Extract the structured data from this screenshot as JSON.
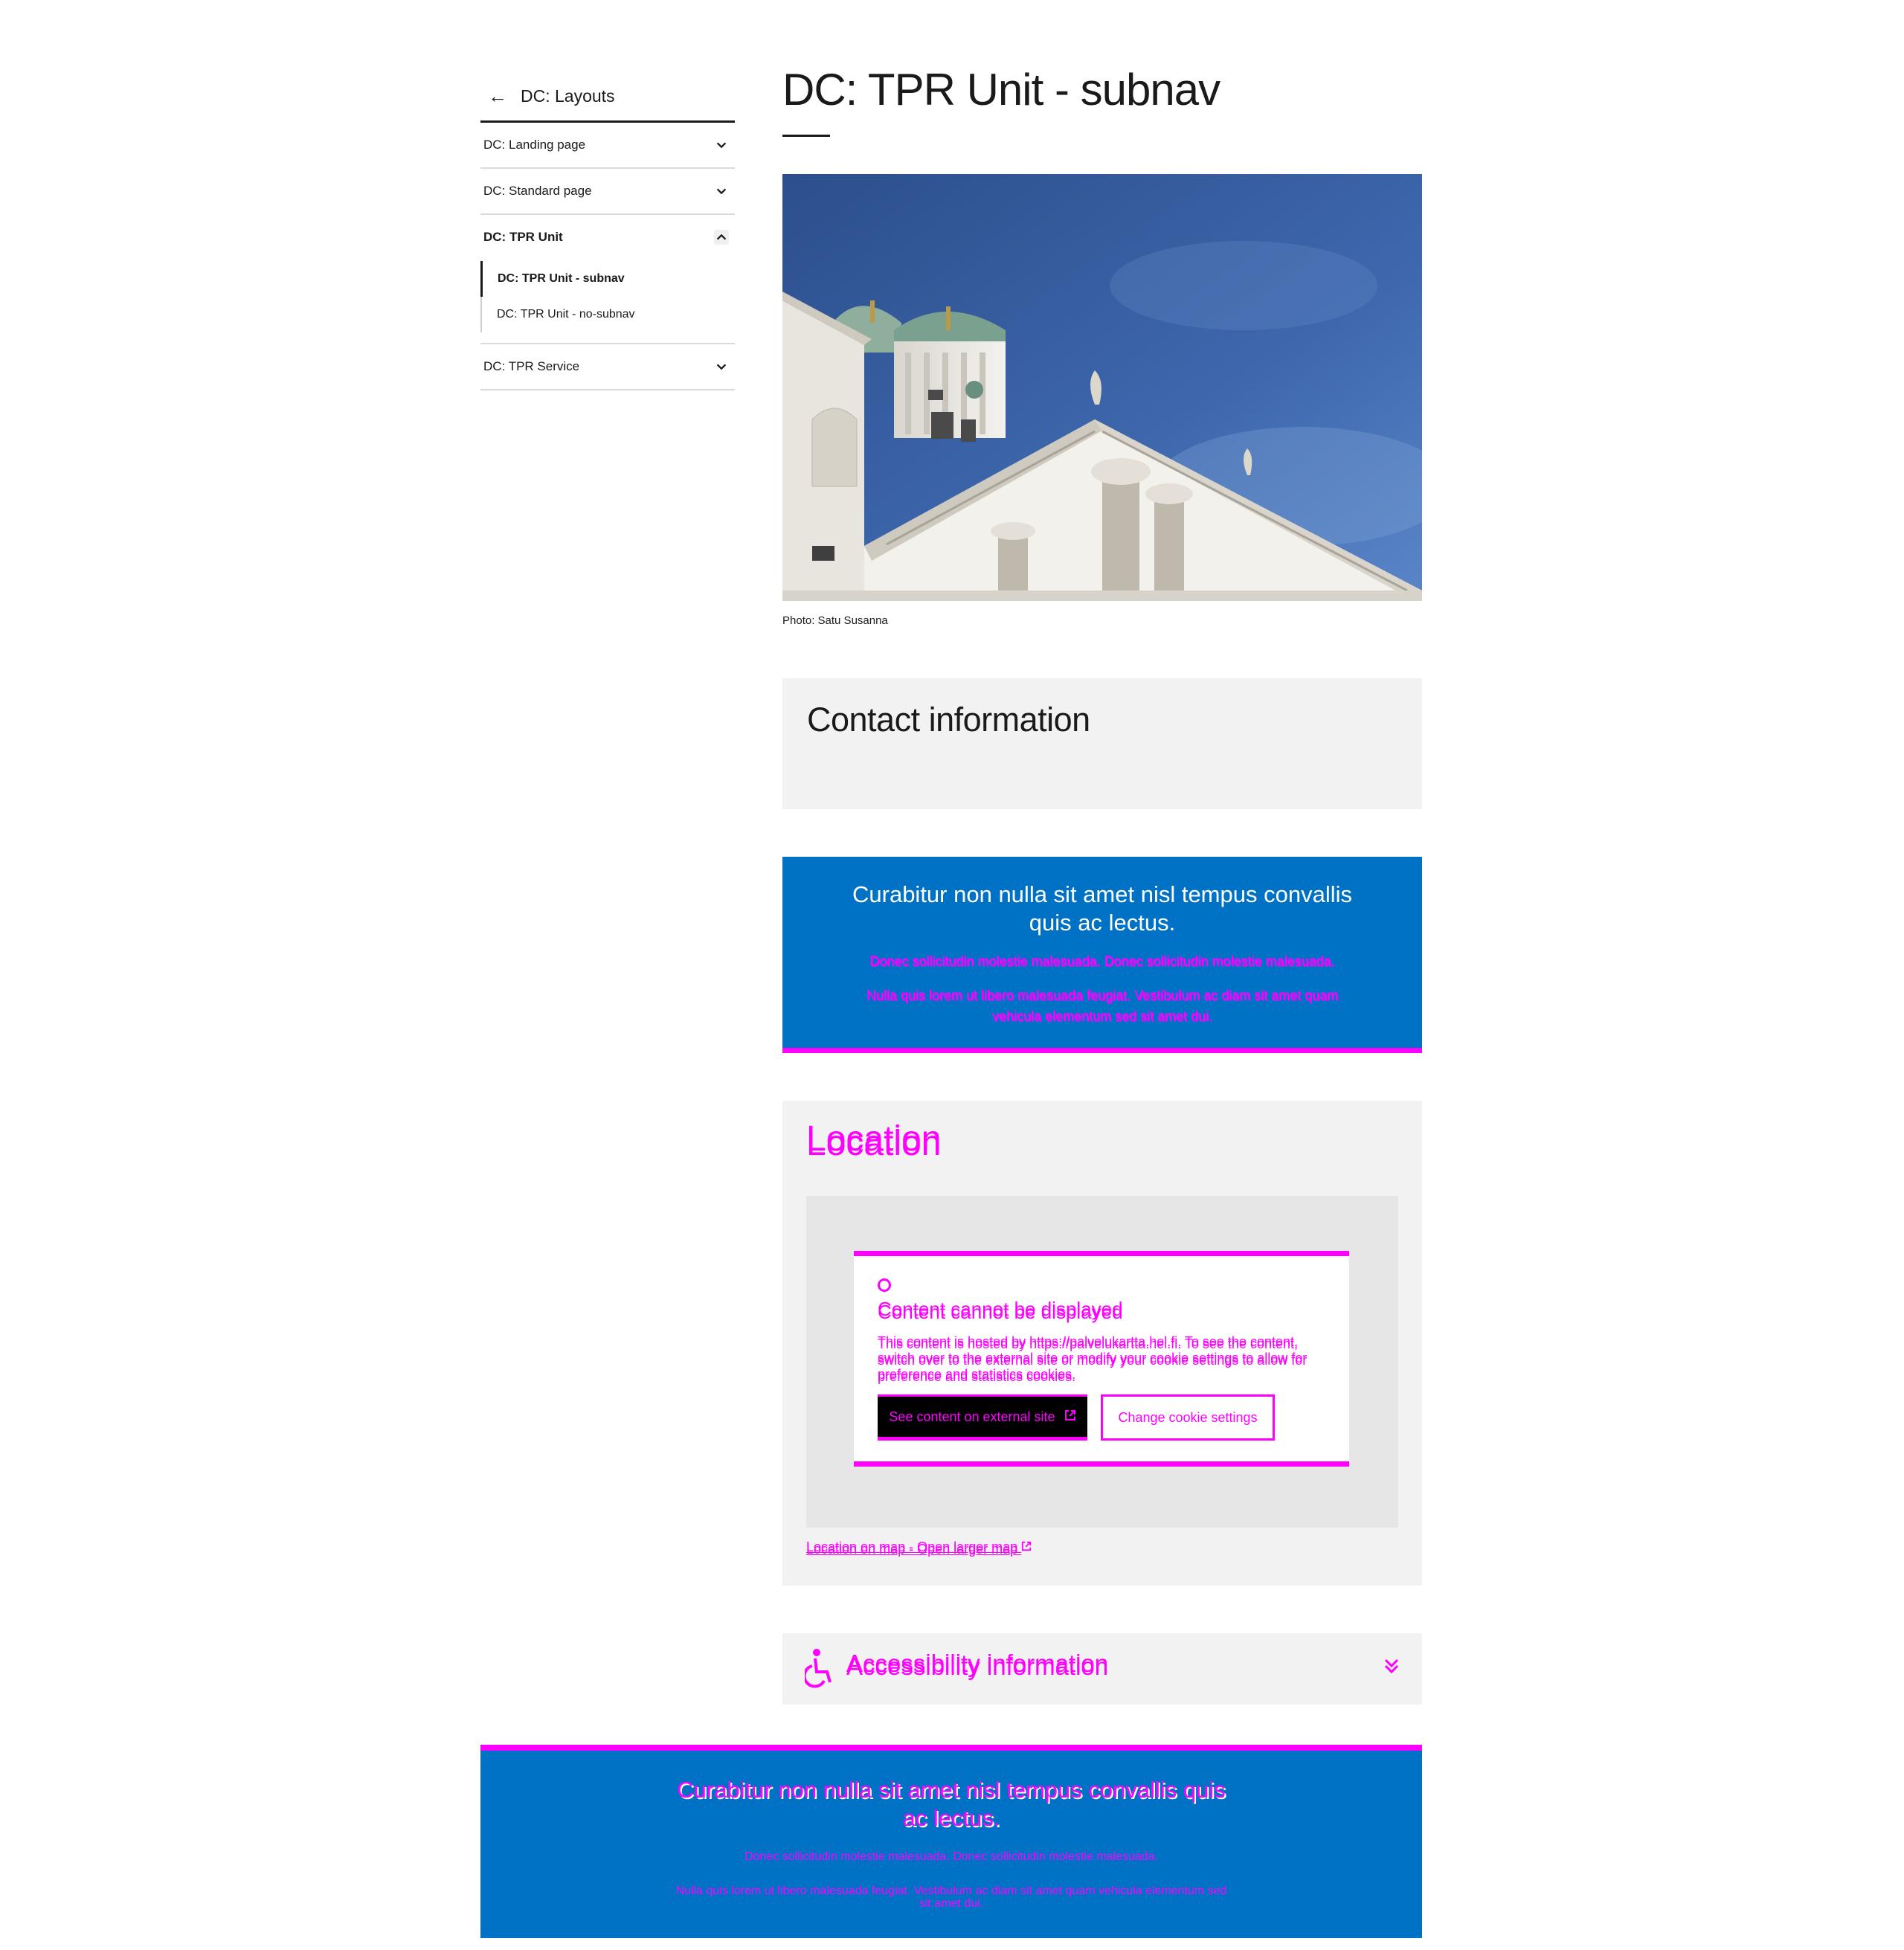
{
  "sidebar": {
    "back_label": "DC: Layouts",
    "items": [
      {
        "label": "DC: Landing page"
      },
      {
        "label": "DC: Standard page"
      },
      {
        "label": "DC: TPR Unit"
      },
      {
        "label": "DC: TPR Service"
      }
    ],
    "sub_items": [
      {
        "label": "DC: TPR Unit - subnav"
      },
      {
        "label": "DC: TPR Unit - no-subnav"
      }
    ]
  },
  "page": {
    "title": "DC: TPR Unit - subnav",
    "image_caption": "Photo: Satu Susanna"
  },
  "contact": {
    "heading": "Contact information"
  },
  "banner_top": {
    "title": "Curabitur non nulla sit amet nisl tempus convallis quis ac lectus.",
    "text1": "Donec sollicitudin molestie malesuada. Donec sollicitudin molestie malesuada.",
    "text2": "Nulla quis lorem ut libero malesuada feugiat. Vestibulum ac diam sit amet quam vehicula elementum sed sit amet dui."
  },
  "location": {
    "heading": "Location",
    "consent_title": "Content cannot be displayed",
    "consent_text": "This content is hosted by https://palvelukartta.hel.fi. To see the content, switch over to the external site or modify your cookie settings to allow for preference and statistics cookies.",
    "external_button": "See content on external site",
    "cookie_button": "Change cookie settings",
    "map_link": "Location on map - Open larger map"
  },
  "accessibility": {
    "heading": "Accessibility information"
  },
  "banner_bottom": {
    "title": "Curabitur non nulla sit amet nisl tempus convallis quis ac lectus.",
    "text1": "Donec sollicitudin molestie malesuada. Donec sollicitudin molestie malesuada.",
    "text2": "Nulla quis lorem ut libero malesuada feugiat. Vestibulum ac diam sit amet quam vehicula elementum sed sit amet dui."
  },
  "colors": {
    "brand_blue": "#0072c6",
    "highlight_magenta": "#ff00ff",
    "panel_grey": "#f2f2f2"
  },
  "icons": {
    "back": "arrow-left-icon",
    "chevron": "chevron-down-icon",
    "external": "external-link-icon",
    "accessibility": "wheelchair-icon"
  }
}
